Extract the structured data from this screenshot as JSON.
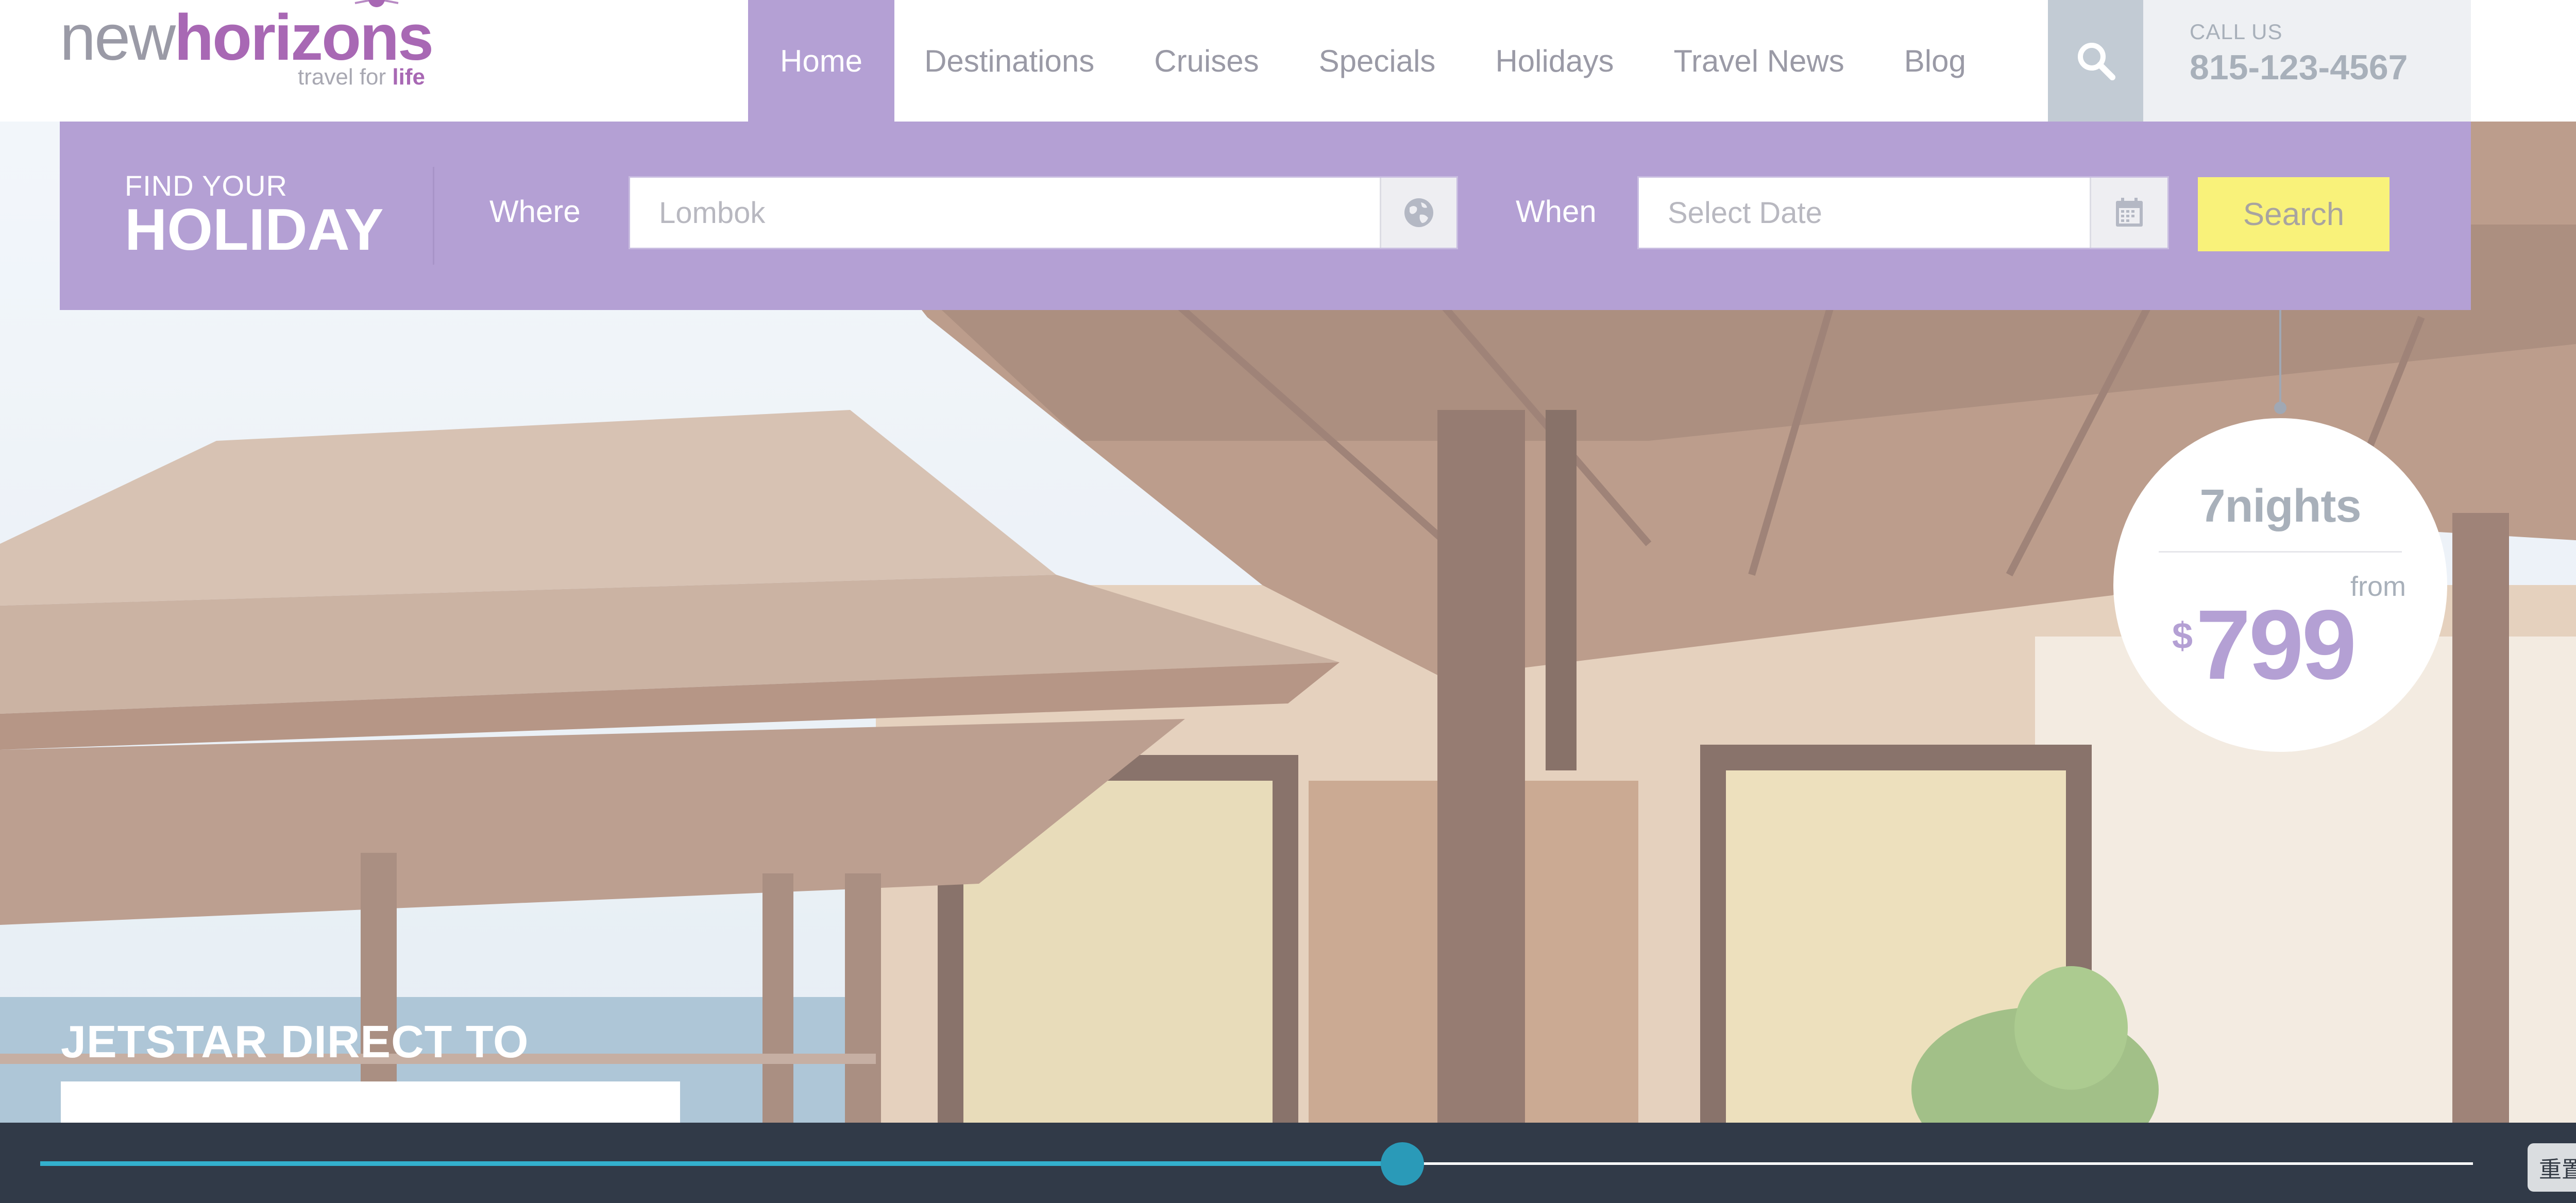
{
  "brand": {
    "name_part1": "new",
    "name_part2": "horizons",
    "tagline_part1": "travel for ",
    "tagline_part2": "life"
  },
  "nav": {
    "items": [
      {
        "label": "Home",
        "active": true
      },
      {
        "label": "Destinations",
        "active": false
      },
      {
        "label": "Cruises",
        "active": false
      },
      {
        "label": "Specials",
        "active": false
      },
      {
        "label": "Holidays",
        "active": false
      },
      {
        "label": "Travel News",
        "active": false
      },
      {
        "label": "Blog",
        "active": false
      }
    ],
    "search_icon": "search-icon"
  },
  "contact": {
    "call_label": "CALL US",
    "phone": "815-123-4567"
  },
  "search_form": {
    "heading_small": "FIND YOUR",
    "heading_big": "HOLIDAY",
    "where_label": "Where",
    "where_placeholder": "Lombok",
    "where_icon": "globe-icon",
    "when_label": "When",
    "when_placeholder": "Select Date",
    "when_icon": "calendar-icon",
    "submit_label": "Search"
  },
  "price_tag": {
    "nights": "7nights",
    "from": "from",
    "currency": "$",
    "price": "799"
  },
  "promo": {
    "heading": "JETSTAR DIRECT TO"
  },
  "slider": {
    "progress_percent": 56,
    "reset_label": "重置"
  },
  "colors": {
    "brand_purple": "#a868b4",
    "band_lavender": "#b4a0d4",
    "search_yellow": "#f9f27a",
    "slider_accent": "#33b0ce",
    "bottom_bar": "#313a48"
  }
}
